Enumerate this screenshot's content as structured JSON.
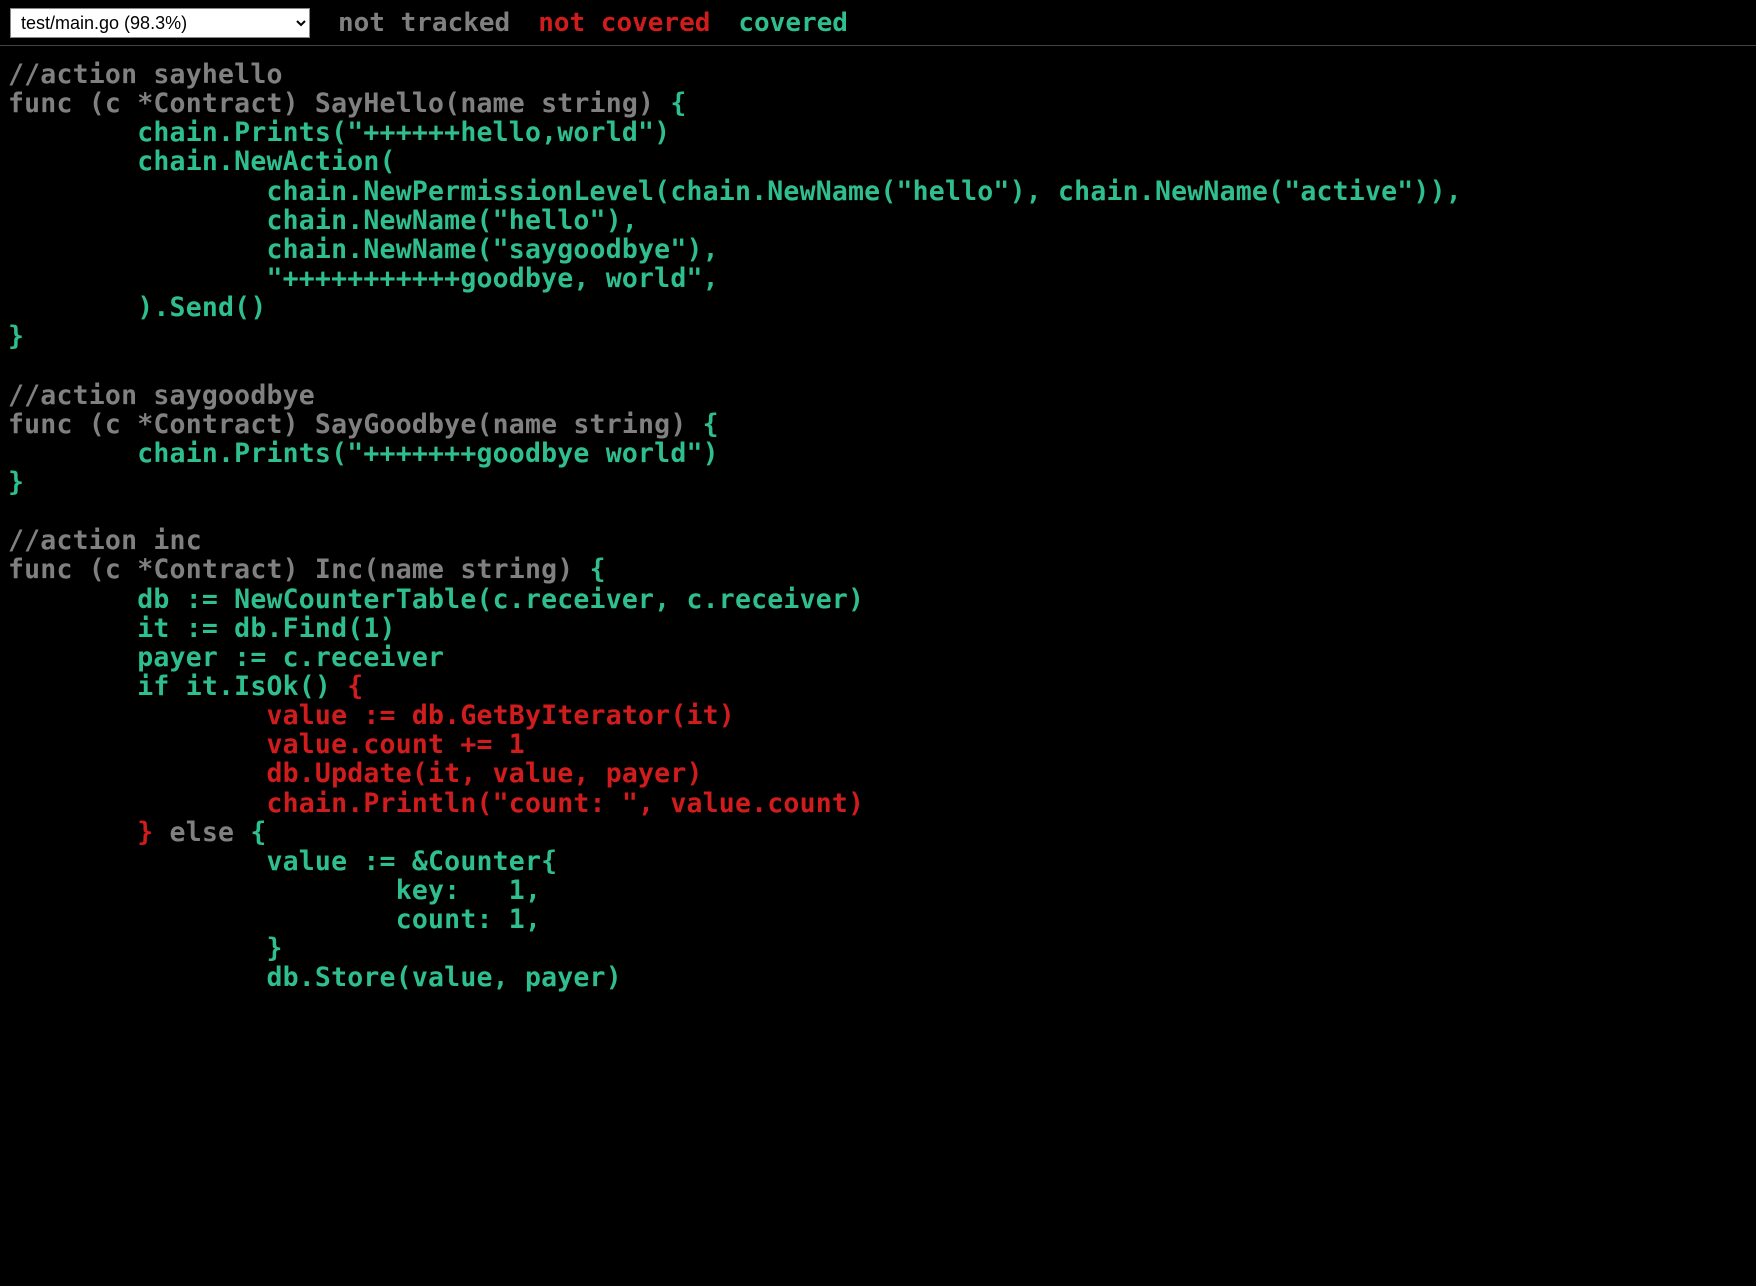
{
  "topbar": {
    "file_select": "test/main.go (98.3%)",
    "legend_not_tracked": "not tracked",
    "legend_not_covered": "not covered",
    "legend_covered": "covered"
  },
  "lines": [
    {
      "cls": "nottracked",
      "text": "//action sayhello"
    },
    {
      "cls": "nottracked",
      "text": "func (c *Contract) SayHello(name string) ",
      "tail": {
        "cls": "covered",
        "text": "{"
      }
    },
    {
      "cls": "covered",
      "text": "        chain.Prints(\"++++++hello,world\")"
    },
    {
      "cls": "covered",
      "text": "        chain.NewAction("
    },
    {
      "cls": "covered",
      "text": "                chain.NewPermissionLevel(chain.NewName(\"hello\"), chain.NewName(\"active\")),"
    },
    {
      "cls": "covered",
      "text": "                chain.NewName(\"hello\"),"
    },
    {
      "cls": "covered",
      "text": "                chain.NewName(\"saygoodbye\"),"
    },
    {
      "cls": "covered",
      "text": "                \"+++++++++++goodbye, world\","
    },
    {
      "cls": "covered",
      "text": "        ).Send()"
    },
    {
      "cls": "covered",
      "text": "}"
    },
    {
      "cls": "nottracked",
      "text": ""
    },
    {
      "cls": "nottracked",
      "text": "//action saygoodbye"
    },
    {
      "cls": "nottracked",
      "text": "func (c *Contract) SayGoodbye(name string) ",
      "tail": {
        "cls": "covered",
        "text": "{"
      }
    },
    {
      "cls": "covered",
      "text": "        chain.Prints(\"+++++++goodbye world\")"
    },
    {
      "cls": "covered",
      "text": "}"
    },
    {
      "cls": "nottracked",
      "text": ""
    },
    {
      "cls": "nottracked",
      "text": "//action inc"
    },
    {
      "cls": "nottracked",
      "text": "func (c *Contract) Inc(name string) ",
      "tail": {
        "cls": "covered",
        "text": "{"
      }
    },
    {
      "cls": "covered",
      "text": "        db := NewCounterTable(c.receiver, c.receiver)"
    },
    {
      "cls": "covered",
      "text": "        it := db.Find(1)"
    },
    {
      "cls": "covered",
      "text": "        payer := c.receiver"
    },
    {
      "cls": "covered",
      "text": "        if it.IsOk() ",
      "tail": {
        "cls": "notcovered",
        "text": "{"
      }
    },
    {
      "cls": "notcovered",
      "text": "                value := db.GetByIterator(it)"
    },
    {
      "cls": "notcovered",
      "text": "                value.count += 1"
    },
    {
      "cls": "notcovered",
      "text": "                db.Update(it, value, payer)"
    },
    {
      "cls": "notcovered",
      "text": "                chain.Println(\"count: \", value.count)"
    },
    {
      "cls": "notcovered",
      "text": "        }",
      "tail": {
        "cls": "nottracked",
        "text": " else ",
        "tail2": {
          "cls": "covered",
          "text": "{"
        }
      }
    },
    {
      "cls": "covered",
      "text": "                value := &Counter{"
    },
    {
      "cls": "covered",
      "text": "                        key:   1,"
    },
    {
      "cls": "covered",
      "text": "                        count: 1,"
    },
    {
      "cls": "covered",
      "text": "                }"
    },
    {
      "cls": "covered",
      "text": "                db.Store(value, payer)"
    }
  ]
}
